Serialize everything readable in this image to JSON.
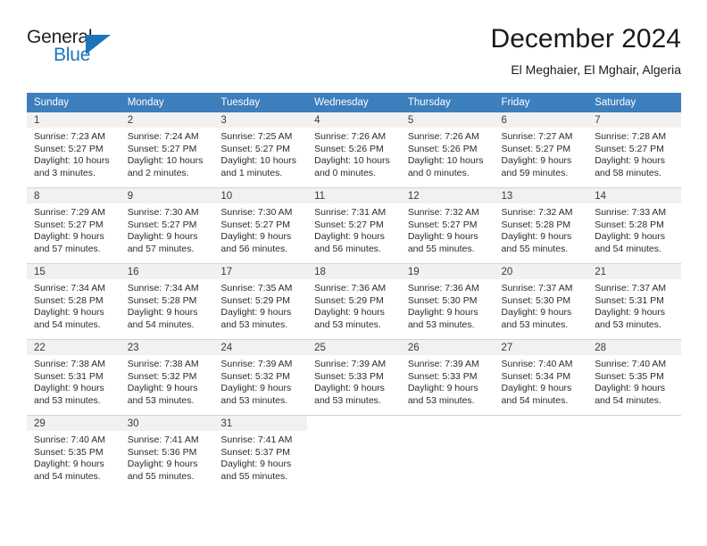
{
  "brand": {
    "name_part1": "General",
    "name_part2": "Blue",
    "accent_color": "#1b75bb",
    "logo_icon": "triangle-icon"
  },
  "header": {
    "title": "December 2024",
    "subtitle": "El Meghaier, El Mghair, Algeria"
  },
  "calendar": {
    "header_bg": "#3d7ebd",
    "daynum_bg": "#f1f1f1",
    "weekdays": [
      "Sunday",
      "Monday",
      "Tuesday",
      "Wednesday",
      "Thursday",
      "Friday",
      "Saturday"
    ],
    "weeks": [
      [
        {
          "day": "1",
          "sunrise": "Sunrise: 7:23 AM",
          "sunset": "Sunset: 5:27 PM",
          "daylight1": "Daylight: 10 hours",
          "daylight2": "and 3 minutes."
        },
        {
          "day": "2",
          "sunrise": "Sunrise: 7:24 AM",
          "sunset": "Sunset: 5:27 PM",
          "daylight1": "Daylight: 10 hours",
          "daylight2": "and 2 minutes."
        },
        {
          "day": "3",
          "sunrise": "Sunrise: 7:25 AM",
          "sunset": "Sunset: 5:27 PM",
          "daylight1": "Daylight: 10 hours",
          "daylight2": "and 1 minutes."
        },
        {
          "day": "4",
          "sunrise": "Sunrise: 7:26 AM",
          "sunset": "Sunset: 5:26 PM",
          "daylight1": "Daylight: 10 hours",
          "daylight2": "and 0 minutes."
        },
        {
          "day": "5",
          "sunrise": "Sunrise: 7:26 AM",
          "sunset": "Sunset: 5:26 PM",
          "daylight1": "Daylight: 10 hours",
          "daylight2": "and 0 minutes."
        },
        {
          "day": "6",
          "sunrise": "Sunrise: 7:27 AM",
          "sunset": "Sunset: 5:27 PM",
          "daylight1": "Daylight: 9 hours",
          "daylight2": "and 59 minutes."
        },
        {
          "day": "7",
          "sunrise": "Sunrise: 7:28 AM",
          "sunset": "Sunset: 5:27 PM",
          "daylight1": "Daylight: 9 hours",
          "daylight2": "and 58 minutes."
        }
      ],
      [
        {
          "day": "8",
          "sunrise": "Sunrise: 7:29 AM",
          "sunset": "Sunset: 5:27 PM",
          "daylight1": "Daylight: 9 hours",
          "daylight2": "and 57 minutes."
        },
        {
          "day": "9",
          "sunrise": "Sunrise: 7:30 AM",
          "sunset": "Sunset: 5:27 PM",
          "daylight1": "Daylight: 9 hours",
          "daylight2": "and 57 minutes."
        },
        {
          "day": "10",
          "sunrise": "Sunrise: 7:30 AM",
          "sunset": "Sunset: 5:27 PM",
          "daylight1": "Daylight: 9 hours",
          "daylight2": "and 56 minutes."
        },
        {
          "day": "11",
          "sunrise": "Sunrise: 7:31 AM",
          "sunset": "Sunset: 5:27 PM",
          "daylight1": "Daylight: 9 hours",
          "daylight2": "and 56 minutes."
        },
        {
          "day": "12",
          "sunrise": "Sunrise: 7:32 AM",
          "sunset": "Sunset: 5:27 PM",
          "daylight1": "Daylight: 9 hours",
          "daylight2": "and 55 minutes."
        },
        {
          "day": "13",
          "sunrise": "Sunrise: 7:32 AM",
          "sunset": "Sunset: 5:28 PM",
          "daylight1": "Daylight: 9 hours",
          "daylight2": "and 55 minutes."
        },
        {
          "day": "14",
          "sunrise": "Sunrise: 7:33 AM",
          "sunset": "Sunset: 5:28 PM",
          "daylight1": "Daylight: 9 hours",
          "daylight2": "and 54 minutes."
        }
      ],
      [
        {
          "day": "15",
          "sunrise": "Sunrise: 7:34 AM",
          "sunset": "Sunset: 5:28 PM",
          "daylight1": "Daylight: 9 hours",
          "daylight2": "and 54 minutes."
        },
        {
          "day": "16",
          "sunrise": "Sunrise: 7:34 AM",
          "sunset": "Sunset: 5:28 PM",
          "daylight1": "Daylight: 9 hours",
          "daylight2": "and 54 minutes."
        },
        {
          "day": "17",
          "sunrise": "Sunrise: 7:35 AM",
          "sunset": "Sunset: 5:29 PM",
          "daylight1": "Daylight: 9 hours",
          "daylight2": "and 53 minutes."
        },
        {
          "day": "18",
          "sunrise": "Sunrise: 7:36 AM",
          "sunset": "Sunset: 5:29 PM",
          "daylight1": "Daylight: 9 hours",
          "daylight2": "and 53 minutes."
        },
        {
          "day": "19",
          "sunrise": "Sunrise: 7:36 AM",
          "sunset": "Sunset: 5:30 PM",
          "daylight1": "Daylight: 9 hours",
          "daylight2": "and 53 minutes."
        },
        {
          "day": "20",
          "sunrise": "Sunrise: 7:37 AM",
          "sunset": "Sunset: 5:30 PM",
          "daylight1": "Daylight: 9 hours",
          "daylight2": "and 53 minutes."
        },
        {
          "day": "21",
          "sunrise": "Sunrise: 7:37 AM",
          "sunset": "Sunset: 5:31 PM",
          "daylight1": "Daylight: 9 hours",
          "daylight2": "and 53 minutes."
        }
      ],
      [
        {
          "day": "22",
          "sunrise": "Sunrise: 7:38 AM",
          "sunset": "Sunset: 5:31 PM",
          "daylight1": "Daylight: 9 hours",
          "daylight2": "and 53 minutes."
        },
        {
          "day": "23",
          "sunrise": "Sunrise: 7:38 AM",
          "sunset": "Sunset: 5:32 PM",
          "daylight1": "Daylight: 9 hours",
          "daylight2": "and 53 minutes."
        },
        {
          "day": "24",
          "sunrise": "Sunrise: 7:39 AM",
          "sunset": "Sunset: 5:32 PM",
          "daylight1": "Daylight: 9 hours",
          "daylight2": "and 53 minutes."
        },
        {
          "day": "25",
          "sunrise": "Sunrise: 7:39 AM",
          "sunset": "Sunset: 5:33 PM",
          "daylight1": "Daylight: 9 hours",
          "daylight2": "and 53 minutes."
        },
        {
          "day": "26",
          "sunrise": "Sunrise: 7:39 AM",
          "sunset": "Sunset: 5:33 PM",
          "daylight1": "Daylight: 9 hours",
          "daylight2": "and 53 minutes."
        },
        {
          "day": "27",
          "sunrise": "Sunrise: 7:40 AM",
          "sunset": "Sunset: 5:34 PM",
          "daylight1": "Daylight: 9 hours",
          "daylight2": "and 54 minutes."
        },
        {
          "day": "28",
          "sunrise": "Sunrise: 7:40 AM",
          "sunset": "Sunset: 5:35 PM",
          "daylight1": "Daylight: 9 hours",
          "daylight2": "and 54 minutes."
        }
      ],
      [
        {
          "day": "29",
          "sunrise": "Sunrise: 7:40 AM",
          "sunset": "Sunset: 5:35 PM",
          "daylight1": "Daylight: 9 hours",
          "daylight2": "and 54 minutes."
        },
        {
          "day": "30",
          "sunrise": "Sunrise: 7:41 AM",
          "sunset": "Sunset: 5:36 PM",
          "daylight1": "Daylight: 9 hours",
          "daylight2": "and 55 minutes."
        },
        {
          "day": "31",
          "sunrise": "Sunrise: 7:41 AM",
          "sunset": "Sunset: 5:37 PM",
          "daylight1": "Daylight: 9 hours",
          "daylight2": "and 55 minutes."
        },
        {
          "day": "",
          "sunrise": "",
          "sunset": "",
          "daylight1": "",
          "daylight2": ""
        },
        {
          "day": "",
          "sunrise": "",
          "sunset": "",
          "daylight1": "",
          "daylight2": ""
        },
        {
          "day": "",
          "sunrise": "",
          "sunset": "",
          "daylight1": "",
          "daylight2": ""
        },
        {
          "day": "",
          "sunrise": "",
          "sunset": "",
          "daylight1": "",
          "daylight2": ""
        }
      ]
    ]
  }
}
